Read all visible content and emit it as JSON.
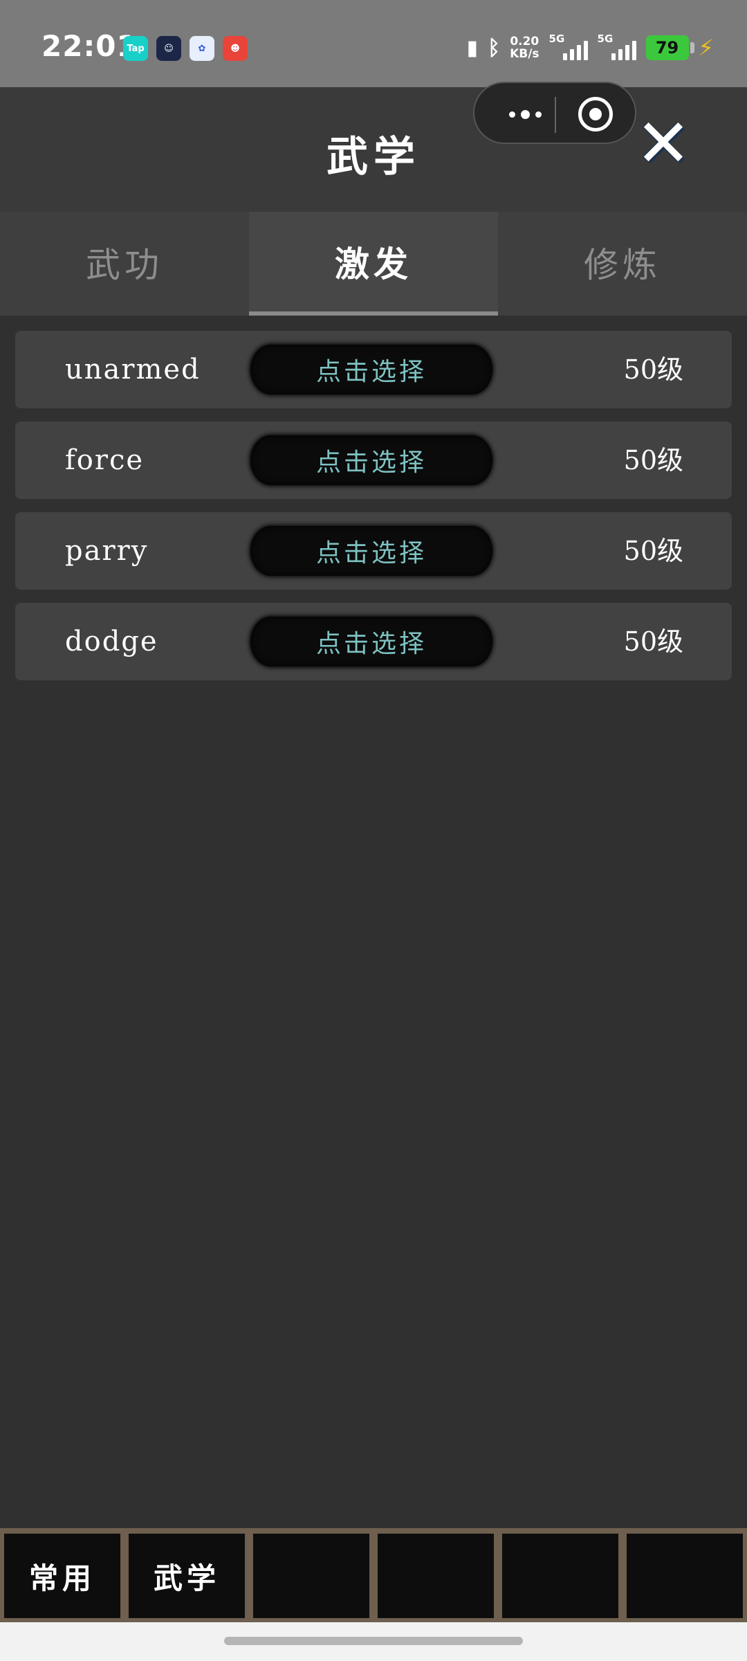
{
  "status_bar": {
    "time": "22:01",
    "apps": [
      {
        "icon": "taptap-app-icon",
        "label": "Tap",
        "color": "#19d0c8"
      },
      {
        "icon": "robot-app-icon",
        "label": "",
        "color": "#1c2748"
      },
      {
        "icon": "baidu-app-icon",
        "label": "",
        "color": "#e7eefc"
      },
      {
        "icon": "xiaohongshu-app-icon",
        "label": "",
        "color": "#e8443a"
      }
    ],
    "net_speed_value": "0.20",
    "net_speed_unit": "KB/s",
    "signal1_label": "5G",
    "signal2_label": "5G",
    "battery": "79"
  },
  "header": {
    "title": "武学",
    "close_label": "✕"
  },
  "tabs": [
    {
      "label": "武功",
      "active": false
    },
    {
      "label": "激发",
      "active": true
    },
    {
      "label": "修炼",
      "active": false
    }
  ],
  "skills": [
    {
      "name": "unarmed",
      "action": "点击选择",
      "level": "50级"
    },
    {
      "name": "force",
      "action": "点击选择",
      "level": "50级"
    },
    {
      "name": "parry",
      "action": "点击选择",
      "level": "50级"
    },
    {
      "name": "dodge",
      "action": "点击选择",
      "level": "50级"
    }
  ],
  "bottom_nav": [
    {
      "label": "常用"
    },
    {
      "label": "武学"
    },
    {
      "label": ""
    },
    {
      "label": ""
    },
    {
      "label": ""
    },
    {
      "label": ""
    }
  ],
  "colors": {
    "background": "#303030",
    "accent_text": "#7fc2c2",
    "bottom_frame": "#6e5f4e"
  }
}
